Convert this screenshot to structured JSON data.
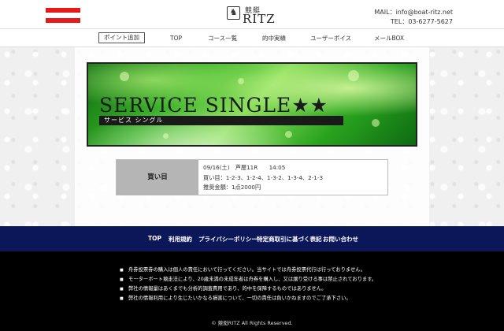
{
  "header": {
    "logo_small": "競艇",
    "logo_big": "RITZ",
    "mail": "MAIL：info@boat-ritz.net",
    "tel": "TEL：03-6277-5627"
  },
  "nav": {
    "items": [
      "ポイント追加",
      "TOP",
      "コース一覧",
      "的中実績",
      "ユーザーボイス",
      "メールBOX"
    ]
  },
  "banner": {
    "title": "SERVICE SINGLE★★",
    "subtitle": "サービス シングル"
  },
  "buy": {
    "label": "買い目",
    "line1": "09/16(土)　芦屋11R　　14:05",
    "line2": "買い目：1-2-3、1-2-4、1-3-2、1-3-4、2-1-3",
    "line3": "推奨金額：1点2000円"
  },
  "footer_nav": {
    "items": [
      "TOP",
      "利用規約",
      "プライバシーポリシー",
      "特定商取引に基づく表記",
      "お問い合わせ"
    ]
  },
  "footer": {
    "notes": [
      "舟券投票券の購入は個人の責任において行ってください。当サイトでは舟券投票代行は行っておりません。",
      "モーターボート競走法により、20歳未満の未成年者は舟券を購入し、又は譲り受ける事は禁止されております。",
      "弊社の情報量はあくまでも分析的調査費用であり、的中を保障するものではありません。",
      "弊社の情報利用により生じたいかなる損害について、一切の責任は負いかねますのでご了承下さい。"
    ],
    "copyright": "© 競艇RITZ All Rights Reserved."
  },
  "colors": {
    "accent_red": "#e51a1a",
    "footer_nav_bg": "#0c1759",
    "footer_bg": "#000000",
    "buy_label_bg": "#b5b5b5"
  },
  "icons": {
    "menu": "hamburger-menu-icon",
    "logo": "lion-crest-icon"
  }
}
